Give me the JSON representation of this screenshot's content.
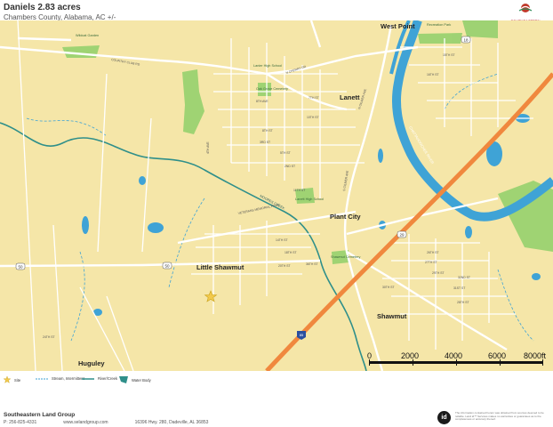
{
  "header": {
    "title": "Daniels 2.83 acres",
    "subtitle": "Chambers County, Alabama,  AC +/-",
    "brand_name": "SOUTHEASTERN",
    "brand_sub": "LAND GROUP",
    "brand_color": "#c0392b"
  },
  "map": {
    "colors": {
      "land": "#f5e6a8",
      "water": "#3fa3d6",
      "road_major": "#ffffff",
      "interstate": "#f0883e",
      "park": "#8fcf6a",
      "creek": "#2f8f8a"
    },
    "places": {
      "west_point": "West Point",
      "lanett": "Lanett",
      "plant_city": "Plant City",
      "little_shawmut": "Little Shawmut",
      "shawmut": "Shawmut",
      "huguley": "Huguley"
    },
    "roads": {
      "country_club": "COUNTRY CLUB RD",
      "veterans": "VETERANS MEMORIAL PKWY",
      "n_cherry": "N CHERRY DR",
      "n_gilmer": "N GILMER AVE",
      "s_gilmer": "S GILMER AVE",
      "chattahoochee": "CHATTAHOOCHEE RIVER",
      "moores_creek": "MOORES CREEK",
      "interstate": "85",
      "route_50": "50",
      "route_18": "18",
      "route_29": "29"
    },
    "streets": [
      "8TH ST",
      "5TH ST",
      "2ND ST",
      "10TH ST",
      "26TH ST",
      "24TH ST",
      "14TH ST",
      "18TH ST",
      "20TH ST",
      "27TH ST",
      "30TH ST",
      "31ST ST",
      "29TH ST",
      "28TH ST",
      "36TH ST",
      "4TH AVE",
      "8TH AVE",
      "11TH ST",
      "3RD ST",
      "15TH ST",
      "16TH ST",
      "32ND ST",
      "7TH ST"
    ],
    "pois": {
      "lanier_school": "Lanier High School",
      "oak_grove": "Oak Grove Cemetery",
      "lanett_school": "Lanett High School",
      "shawmut_cemetery": "Shawmut Cemetery",
      "wildcat_garden": "Wildcat Garden",
      "rec_park": "Recreation Park"
    },
    "marker": "site-star"
  },
  "scale": {
    "labels": [
      "0",
      "2000",
      "4000",
      "6000",
      "8000ft"
    ]
  },
  "legend": {
    "site": "Site",
    "stream": "Stream, Intermittent",
    "river": "River/Creek",
    "water_body": "Water Body"
  },
  "footer": {
    "company": "Southeastern Land Group",
    "phone": "P: 256-825-4331",
    "web": "www.selandgroup.com",
    "address": "16396 Hwy. 280, Dadeville, AL 36853",
    "id_logo": "id",
    "disclaimer": "The information contained herein was obtained from sources deemed to be reliable. Land id™ Services makes no warranties or guarantees as to the completeness or accuracy thereof."
  }
}
